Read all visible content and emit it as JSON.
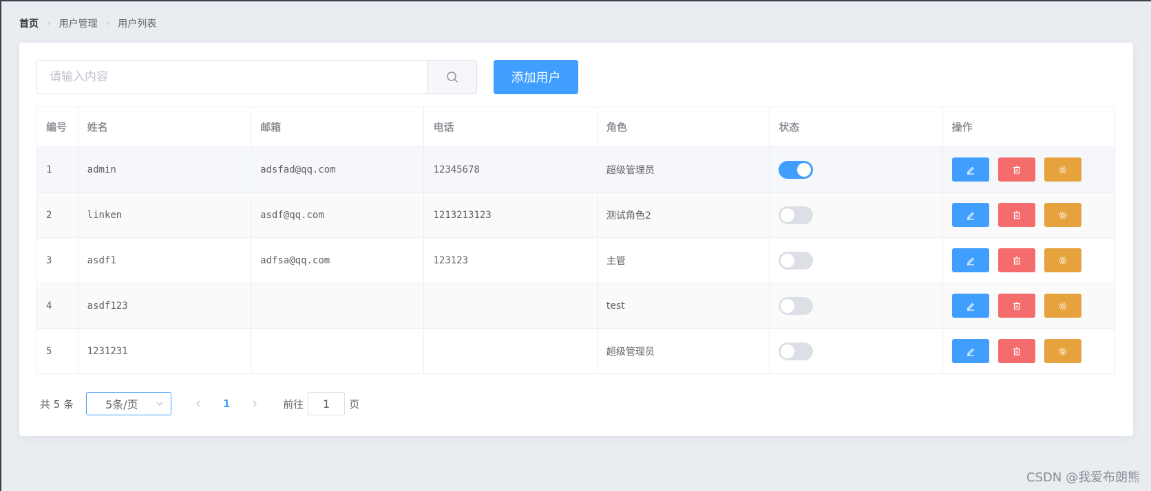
{
  "breadcrumb": [
    "首页",
    "用户管理",
    "用户列表"
  ],
  "search": {
    "placeholder": "请输入内容",
    "value": ""
  },
  "add_button_label": "添加用户",
  "table": {
    "headers": [
      "编号",
      "姓名",
      "邮箱",
      "电话",
      "角色",
      "状态",
      "操作"
    ],
    "rows": [
      {
        "id": "1",
        "name": "admin",
        "email": "adsfad@qq.com",
        "phone": "12345678",
        "role": "超级管理员",
        "status": true
      },
      {
        "id": "2",
        "name": "linken",
        "email": "asdf@qq.com",
        "phone": "1213213123",
        "role": "测试角色2",
        "status": false
      },
      {
        "id": "3",
        "name": "asdf1",
        "email": "adfsa@qq.com",
        "phone": "123123",
        "role": "主管",
        "status": false
      },
      {
        "id": "4",
        "name": "asdf123",
        "email": "",
        "phone": "",
        "role": "test",
        "status": false
      },
      {
        "id": "5",
        "name": "1231231",
        "email": "",
        "phone": "",
        "role": "超级管理员",
        "status": false
      }
    ]
  },
  "pagination": {
    "total_text": "共 5 条",
    "page_size_text": "5条/页",
    "current_page": "1",
    "goto_prefix": "前往",
    "goto_value": "1",
    "goto_suffix": "页"
  },
  "watermark": "CSDN @我爱布朗熊",
  "colors": {
    "primary": "#409eff",
    "danger": "#f56c6c",
    "warning": "#e6a23c"
  }
}
